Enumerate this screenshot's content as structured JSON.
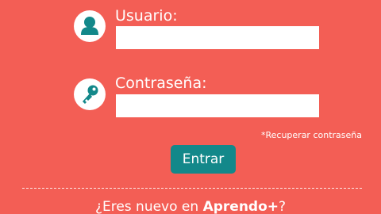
{
  "colors": {
    "background": "#f35e55",
    "icon_circle": "#ffffff",
    "icon_glyph": "#13888a",
    "button": "#13888a",
    "text": "#ffffff"
  },
  "login_form": {
    "username": {
      "icon": "user-icon",
      "label": "Usuario:",
      "value": ""
    },
    "password": {
      "icon": "key-icon",
      "label": "Contraseña:",
      "value": ""
    },
    "recover_link": "*Recuperar contraseña",
    "submit_label": "Entrar"
  },
  "register": {
    "prompt": "¿Eres nuevo en ",
    "brand": "Aprendo+",
    "suffix": "?"
  }
}
